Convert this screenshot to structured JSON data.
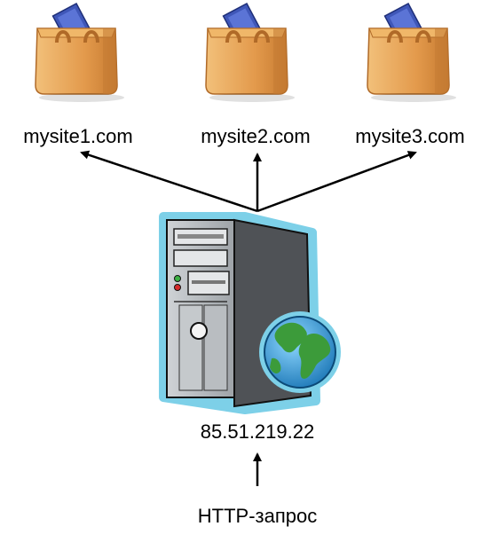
{
  "sites": [
    {
      "name": "mysite1.com",
      "icon": "shopping-bag-icon"
    },
    {
      "name": "mysite2.com",
      "icon": "shopping-bag-icon"
    },
    {
      "name": "mysite3.com",
      "icon": "shopping-bag-icon"
    }
  ],
  "server": {
    "ip": "85.51.219.22",
    "icon": "web-server-globe-icon"
  },
  "request": {
    "label": "HTTP-запрос"
  },
  "colors": {
    "bag": "#e7a75c",
    "bag_dark": "#c27a33",
    "book": "#3f57b8",
    "server_body": "#5b5e62",
    "server_outline": "#7dd0e8",
    "globe_ocean": "#3aa0d8",
    "globe_land": "#3c9b3a",
    "arrow": "#000000"
  }
}
